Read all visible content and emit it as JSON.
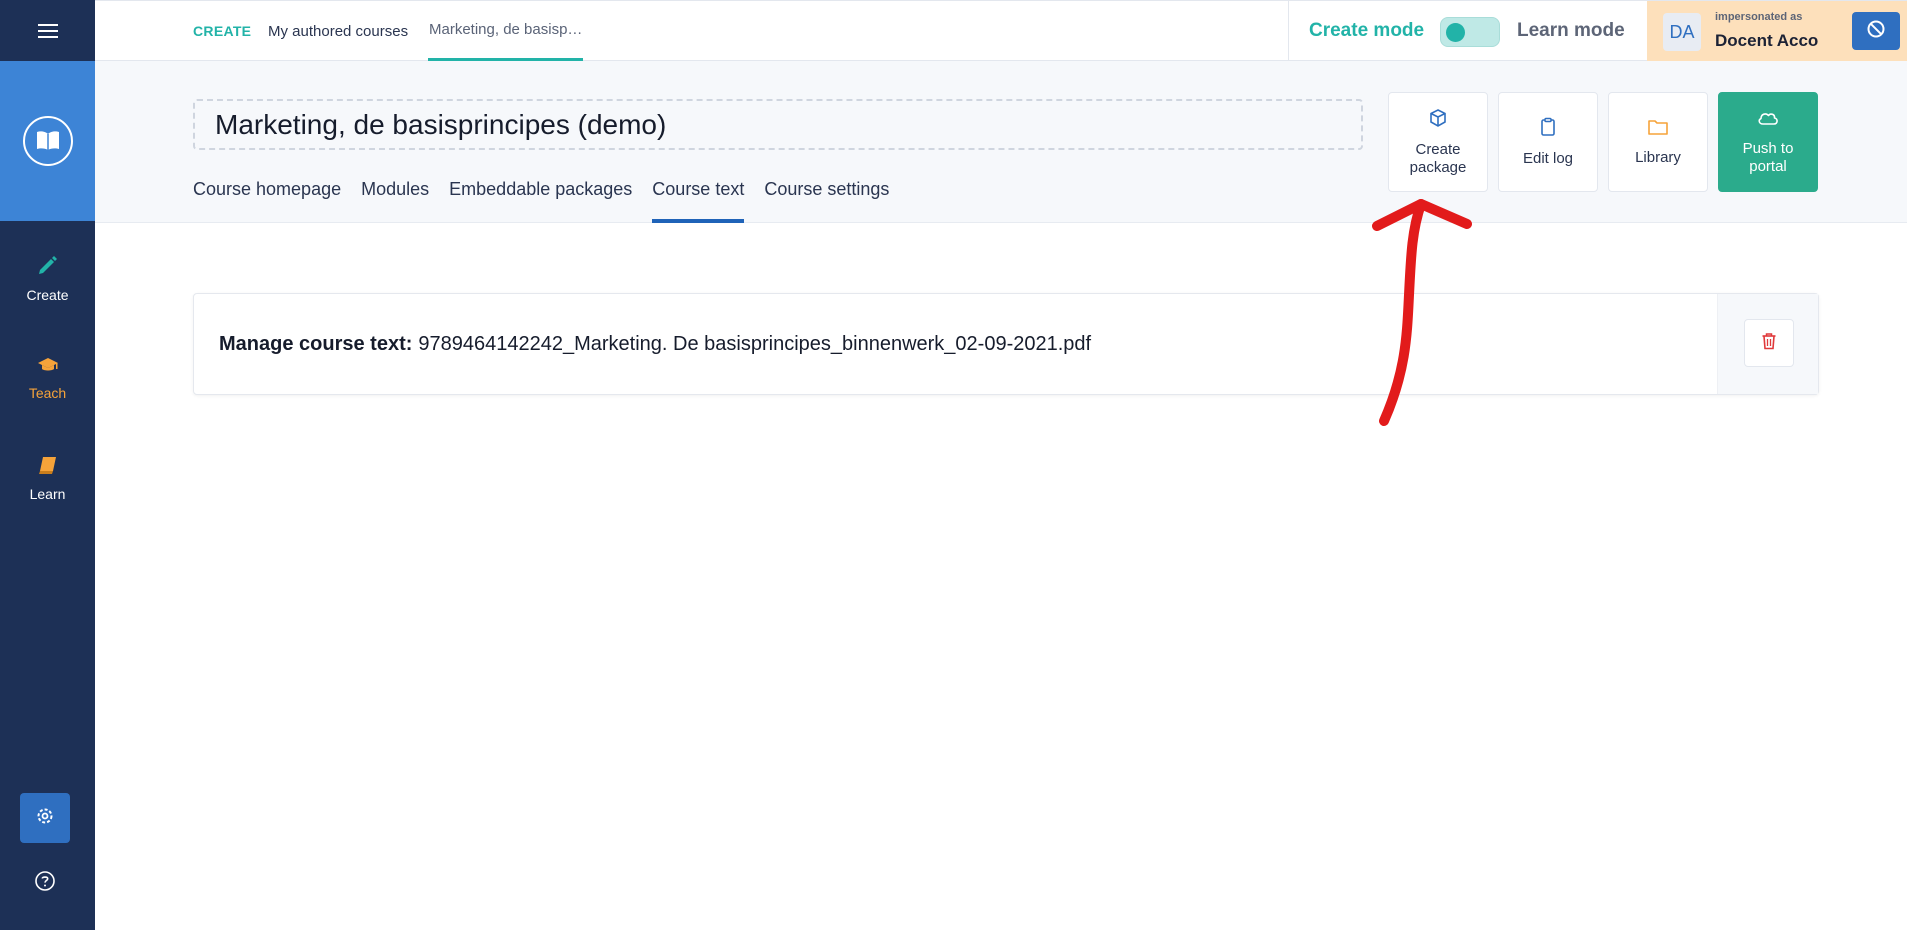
{
  "sidebar": {
    "items": [
      {
        "label": "Create",
        "color": "#ffffff",
        "icon_color": "#22b3a8"
      },
      {
        "label": "Teach",
        "color": "#f6a33a",
        "icon_color": "#f6a33a"
      },
      {
        "label": "Learn",
        "color": "#ffffff",
        "icon_color": "#f6a33a"
      }
    ]
  },
  "breadcrumb": {
    "root": "CREATE",
    "authored": "My authored courses",
    "current": "Marketing, de basisp…"
  },
  "mode": {
    "create_label": "Create mode",
    "learn_label": "Learn mode"
  },
  "impersonation": {
    "initials": "DA",
    "label": "impersonated as",
    "name": "Docent Acco"
  },
  "course": {
    "title": "Marketing, de basisprincipes (demo)",
    "tabs": [
      {
        "label": "Course homepage"
      },
      {
        "label": "Modules"
      },
      {
        "label": "Embeddable packages"
      },
      {
        "label": "Course text",
        "active": true
      },
      {
        "label": "Course settings"
      }
    ]
  },
  "actions": {
    "create_package": "Create package",
    "edit_log": "Edit log",
    "library": "Library",
    "push_to_portal": "Push to portal"
  },
  "course_text": {
    "label": "Manage course text:",
    "filename": "9789464142242_Marketing. De basisprincipes_binnenwerk_02-09-2021.pdf"
  },
  "colors": {
    "sidebar": "#1d3056",
    "accent_teal": "#22b3a8",
    "primary_blue": "#2f6fc0",
    "push_green": "#2bab8c",
    "impersonation_bg": "#fde0bb",
    "annotation_red": "#e21b1b"
  }
}
